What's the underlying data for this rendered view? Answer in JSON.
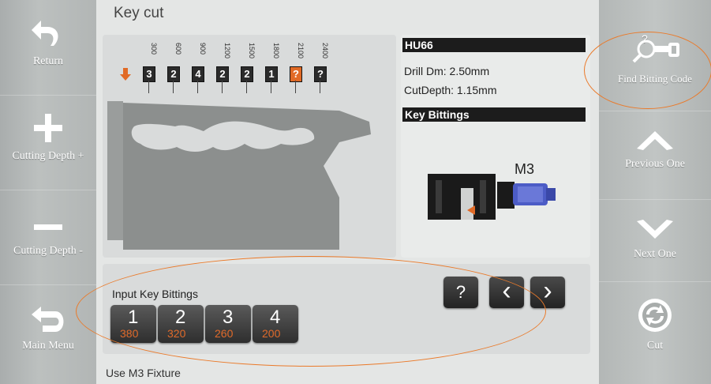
{
  "screen": {
    "title": "Key cut",
    "footer": "Use M3 Fixture"
  },
  "left_sidebar": {
    "items": [
      {
        "label": "Return",
        "icon": "return-arrow-icon"
      },
      {
        "label": "Cutting Depth +",
        "icon": "plus-icon"
      },
      {
        "label": "Cutting Depth -",
        "icon": "minus-icon"
      },
      {
        "label": "Main Menu",
        "icon": "main-menu-arrow-icon"
      }
    ]
  },
  "right_sidebar": {
    "items": [
      {
        "label": "Find Bitting Code",
        "icon": "key-search-icon"
      },
      {
        "label": "Previous One",
        "icon": "chevron-up-icon"
      },
      {
        "label": "Next One",
        "icon": "chevron-down-icon"
      },
      {
        "label": "Cut",
        "icon": "cut-cycle-icon"
      }
    ]
  },
  "key_diagram": {
    "positions": [
      "300",
      "600",
      "900",
      "1200",
      "1500",
      "1800",
      "2100",
      "2400"
    ],
    "cuts": [
      "3",
      "2",
      "4",
      "2",
      "2",
      "1",
      "?",
      "?"
    ],
    "current_marker_icon": "down-arrow-icon"
  },
  "key_info": {
    "model": "HU66",
    "drill": "Drill Dm: 2.50mm",
    "cut_depth": "CutDepth: 1.15mm",
    "bittings_header": "Key Bittings",
    "fixture": "M3"
  },
  "input_panel": {
    "label": "Input Key Bittings",
    "bittings": [
      {
        "number": "1",
        "value": "380"
      },
      {
        "number": "2",
        "value": "320"
      },
      {
        "number": "3",
        "value": "260"
      },
      {
        "number": "4",
        "value": "200"
      }
    ],
    "help_label": "?",
    "prev_label": "‹",
    "next_label": "›"
  },
  "colors": {
    "accent": "#e16a26",
    "annotation": "#ea7a2a",
    "dark_bar": "#1c1c1c"
  }
}
